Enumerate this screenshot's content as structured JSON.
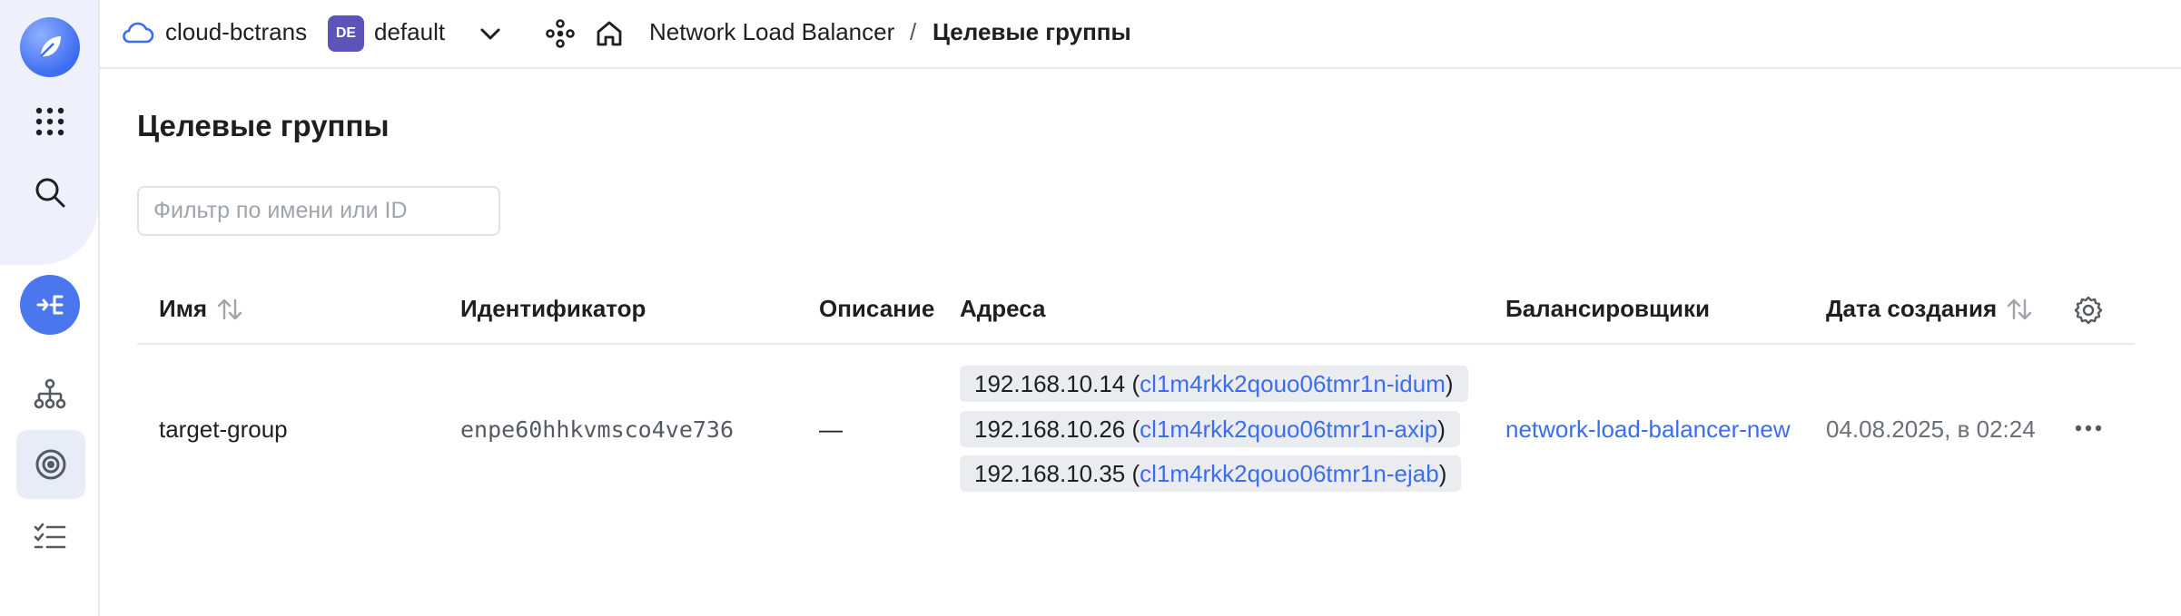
{
  "topbar": {
    "cloud_name": "cloud-bctrans",
    "folder_badge": "DE",
    "folder_name": "default",
    "breadcrumb_service": "Network Load Balancer",
    "breadcrumb_separator": "/",
    "breadcrumb_current": "Целевые группы"
  },
  "page": {
    "title": "Целевые группы",
    "filter_placeholder": "Фильтр по имени или ID"
  },
  "table": {
    "headers": {
      "name": "Имя",
      "id": "Идентификатор",
      "description": "Описание",
      "addresses": "Адреса",
      "balancers": "Балансировщики",
      "created": "Дата создания"
    },
    "rows": [
      {
        "name": "target-group",
        "id": "enpe60hhkvmsco4ve736",
        "description": "—",
        "addresses": [
          {
            "ip": "192.168.10.14",
            "instance": "cl1m4rkk2qouo06tmr1n-idum"
          },
          {
            "ip": "192.168.10.26",
            "instance": "cl1m4rkk2qouo06tmr1n-axip"
          },
          {
            "ip": "192.168.10.35",
            "instance": "cl1m4rkk2qouo06tmr1n-ejab"
          }
        ],
        "balancer": "network-load-balancer-new",
        "created": "04.08.2025, в 02:24"
      }
    ]
  },
  "icons": {
    "rail": [
      "logo-icon",
      "apps-grid-icon",
      "search-icon",
      "network-load-balancer-icon",
      "topology-icon",
      "target-groups-icon",
      "checklist-icon"
    ],
    "topbar": [
      "cloud-icon",
      "chevron-down-icon",
      "nodes-icon",
      "home-icon"
    ],
    "table": [
      "sort-icon",
      "settings-gear-icon",
      "more-dots-icon"
    ]
  },
  "colors": {
    "accent": "#4a77ee",
    "link": "#3b6df0",
    "folder_badge": "#5b55b9",
    "chip_bg": "#eaecef"
  }
}
